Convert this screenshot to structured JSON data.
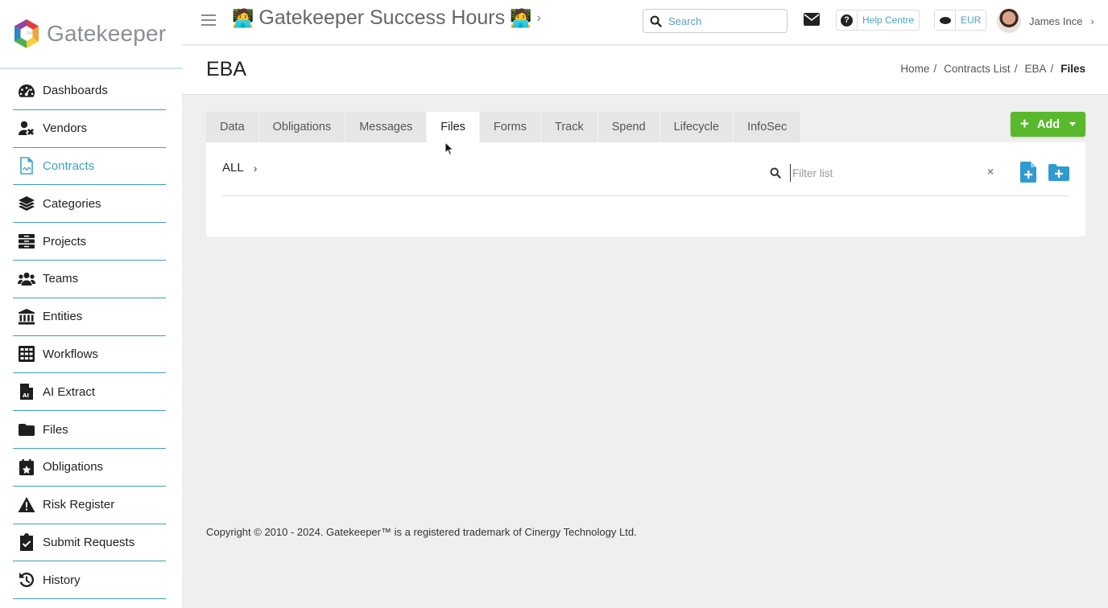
{
  "brand": {
    "name": "Gatekeeper"
  },
  "sidebar": {
    "items": [
      {
        "label": "Dashboards",
        "icon": "dashboard-icon"
      },
      {
        "label": "Vendors",
        "icon": "vendor-icon"
      },
      {
        "label": "Contracts",
        "icon": "contract-icon",
        "active": true
      },
      {
        "label": "Categories",
        "icon": "layers-icon"
      },
      {
        "label": "Projects",
        "icon": "project-icon"
      },
      {
        "label": "Teams",
        "icon": "team-icon"
      },
      {
        "label": "Entities",
        "icon": "bank-icon"
      },
      {
        "label": "Workflows",
        "icon": "workflow-icon"
      },
      {
        "label": "AI Extract",
        "icon": "ai-extract-icon"
      },
      {
        "label": "Files",
        "icon": "folder-icon"
      },
      {
        "label": "Obligations",
        "icon": "calendar-icon"
      },
      {
        "label": "Risk Register",
        "icon": "warning-icon"
      },
      {
        "label": "Submit Requests",
        "icon": "clipboard-check-icon"
      },
      {
        "label": "History",
        "icon": "history-icon"
      }
    ]
  },
  "topbar": {
    "workspace_emoji": "🧑‍💻",
    "workspace_title": "Gatekeeper Success Hours",
    "search_placeholder": "Search",
    "help_label": "Help Centre",
    "currency": "EUR",
    "user_name": "James Ince"
  },
  "page": {
    "title": "EBA",
    "breadcrumbs": [
      "Home",
      "Contracts List",
      "EBA",
      "Files"
    ]
  },
  "tabs": [
    "Data",
    "Obligations",
    "Messages",
    "Files",
    "Forms",
    "Track",
    "Spend",
    "Lifecycle",
    "InfoSec"
  ],
  "active_tab": "Files",
  "add_button": {
    "label": "Add"
  },
  "files_panel": {
    "folder_label": "ALL",
    "filter_placeholder": "Filter list",
    "clear_label": "×"
  },
  "footer": {
    "text": "Copyright © 2010 - 2024. Gatekeeper™ is a registered trademark of Cinergy Technology Ltd."
  },
  "colors": {
    "accent": "#3aa3c7",
    "add_button": "#5ab82d",
    "nav_divider": "#3aa0b8"
  }
}
